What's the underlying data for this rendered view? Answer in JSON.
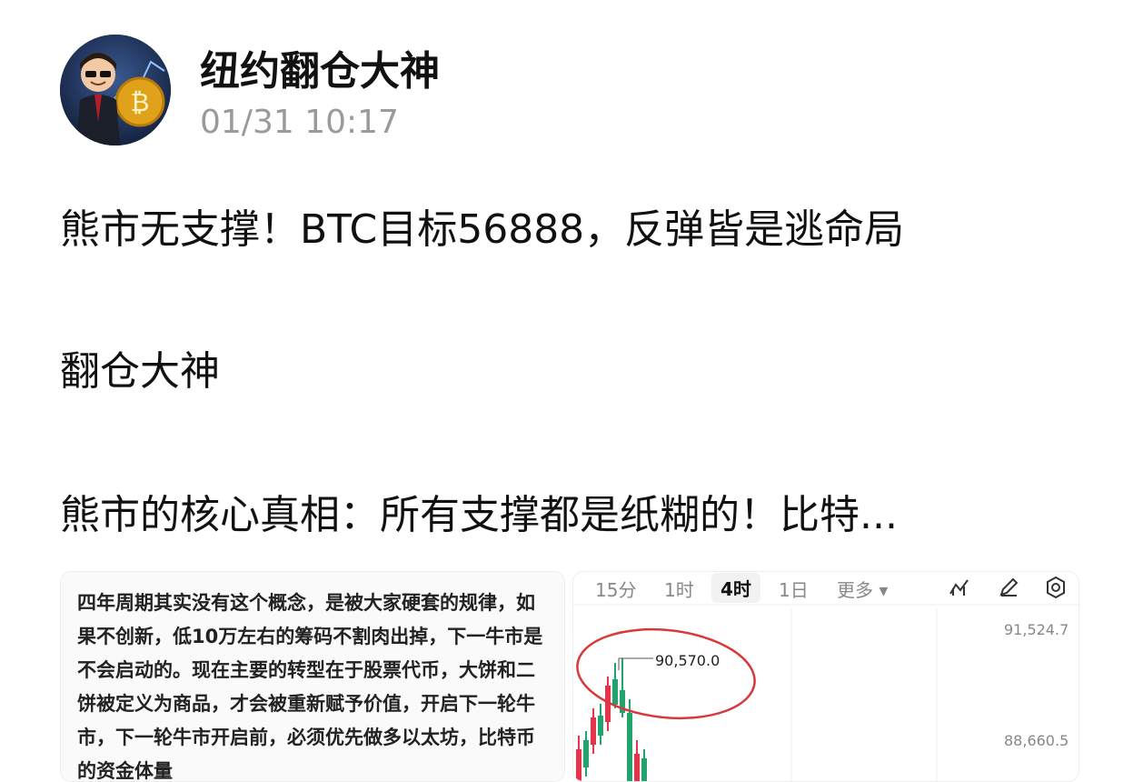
{
  "author": {
    "name": "纽约翻仓大神",
    "time": "01/31 10:17"
  },
  "post": {
    "title": "熊市无支撑！BTC目标56888，反弹皆是逃命局",
    "subtitle": "翻仓大神",
    "excerpt": "熊市的核心真相：所有支撑都是纸糊的！比特..."
  },
  "image_left": {
    "text": "四年周期其实没有这个概念，是被大家硬套的规律，如果不创新，低10万左右的筹码不割肉出掉，下一牛市是不会启动的。现在主要的转型在于股票代币，大饼和二饼被定义为商品，才会被重新赋予价值，开启下一轮牛市，下一轮牛市开启前，必须优先做多以太坊，比特币的资金体量"
  },
  "image_right": {
    "tabs": [
      "15分",
      "1时",
      "4时",
      "1日",
      "更多 ▾"
    ],
    "active_tab": "4时",
    "tools": [
      "indicator-icon",
      "pen-icon",
      "settings-icon"
    ],
    "price_labels": {
      "top": "91,524.7",
      "mid": "88,660.5"
    },
    "annotation": "90,570.0",
    "colors": {
      "up": "#21a36b",
      "down": "#e5334b",
      "circle": "#d9383a"
    }
  }
}
